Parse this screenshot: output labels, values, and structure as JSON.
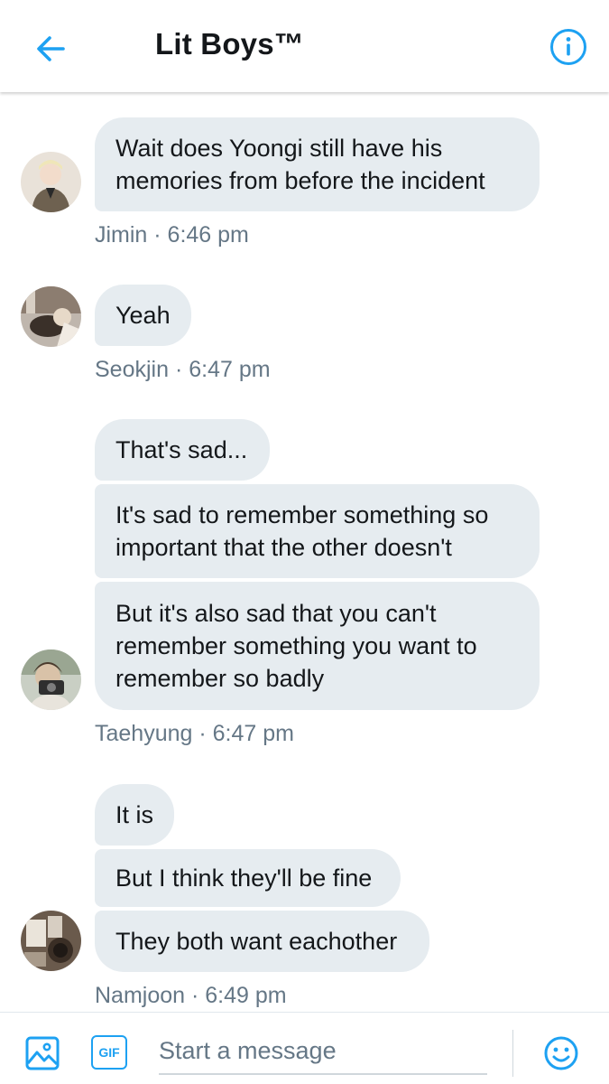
{
  "header": {
    "title": "Lit Boys™"
  },
  "groups": [
    {
      "sender": "Jimin",
      "time": "6:46 pm",
      "meta": "Jimin · 6:46 pm",
      "messages": [
        "Wait does Yoongi still have his",
        "memories from before the incident"
      ]
    },
    {
      "sender": "Seokjin",
      "time": "6:47 pm",
      "meta": "Seokjin · 6:47 pm",
      "messages": [
        "Yeah"
      ]
    },
    {
      "sender": "Taehyung",
      "time": "6:47 pm",
      "meta": "Taehyung · 6:47 pm",
      "messages": [
        "That's sad...",
        "It's sad to remember something so",
        "important that the other doesn't",
        "But it's also sad that you can't",
        "remember something you want to",
        "remember so badly"
      ]
    },
    {
      "sender": "Namjoon",
      "time": "6:49 pm",
      "meta": "Namjoon · 6:49 pm",
      "messages": [
        "It is",
        "But I think they'll be fine",
        "They both want eachother"
      ]
    }
  ],
  "composer": {
    "placeholder": "Start a message",
    "gif_label": "GIF"
  },
  "icons": {
    "back": "arrow-left-icon",
    "info": "info-icon",
    "image": "image-icon",
    "gif": "gif-icon",
    "emoji": "emoji-icon"
  },
  "colors": {
    "accent": "#1da1f2",
    "bubble": "#e6ecf0",
    "meta_text": "#657786",
    "text": "#14171a"
  }
}
